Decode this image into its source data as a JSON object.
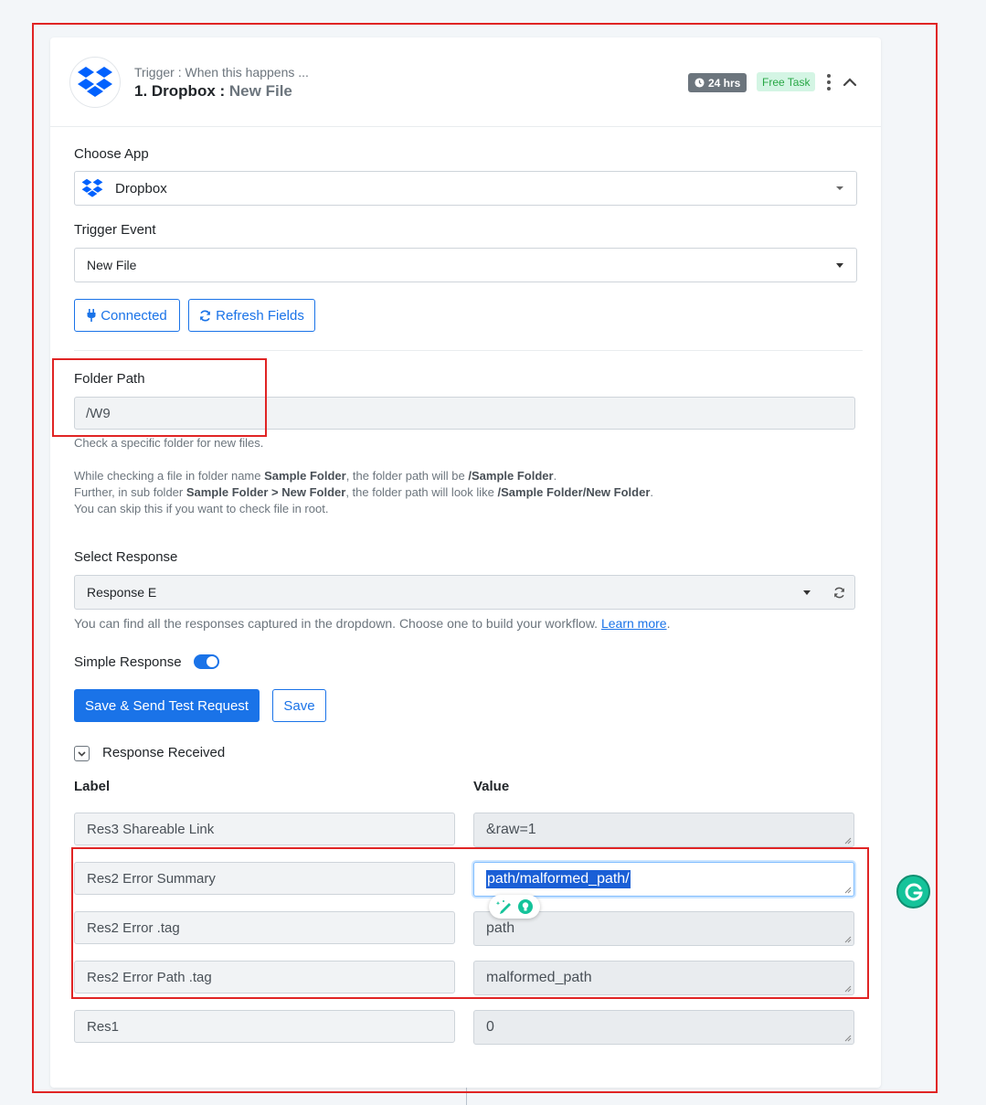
{
  "header": {
    "subtitle": "Trigger : When this happens ...",
    "title_prefix": "1. Dropbox :",
    "title_event": "New File",
    "hours_badge": "24 hrs",
    "task_badge": "Free Task"
  },
  "choose_app": {
    "label": "Choose App",
    "value": "Dropbox"
  },
  "trigger_event": {
    "label": "Trigger Event",
    "value": "New File"
  },
  "buttons": {
    "connected": "Connected",
    "refresh_fields": "Refresh Fields",
    "save_send": "Save & Send Test Request",
    "save": "Save"
  },
  "folder_path": {
    "label": "Folder Path",
    "value": "/W9",
    "help1": "Check a specific folder for new files.",
    "help2_a": "While checking a file in folder name ",
    "help2_b": "Sample Folder",
    "help2_c": ", the folder path will be ",
    "help2_d": "/Sample Folder",
    "help2_e": ".",
    "help3_a": "Further, in sub folder ",
    "help3_b": "Sample Folder > New Folder",
    "help3_c": ", the folder path will look like ",
    "help3_d": "/Sample Folder/New Folder",
    "help3_e": ".",
    "help4": "You can skip this if you want to check file in root."
  },
  "select_response": {
    "label": "Select Response",
    "value": "Response E",
    "help_text": "You can find all the responses captured in the dropdown. Choose one to build your workflow. ",
    "help_link": "Learn more",
    "help_end": "."
  },
  "simple_response": {
    "label": "Simple Response",
    "enabled": true
  },
  "response_received": {
    "label": "Response Received"
  },
  "table": {
    "label_header": "Label",
    "value_header": "Value",
    "rows": [
      {
        "label": "Res3 Shareable Link",
        "value": "&raw=1"
      },
      {
        "label": "Res2 Error Summary",
        "value": "path/malformed_path/"
      },
      {
        "label": "Res2 Error .tag",
        "value": "path"
      },
      {
        "label": "Res2 Error Path .tag",
        "value": "malformed_path"
      },
      {
        "label": "Res1",
        "value": "0"
      }
    ]
  },
  "colors": {
    "accent": "#1a73e8",
    "annotation": "#e02424",
    "free_task_bg": "#d4f5e4",
    "grammarly": "#15c39a"
  },
  "icons": [
    "dropbox-icon",
    "clock-icon",
    "kebab-icon",
    "chevron-up-icon",
    "plug-icon",
    "refresh-icon",
    "caret-down-icon",
    "chevron-down-icon",
    "grammarly-icon",
    "pencil-sparkle-icon",
    "lightbulb-icon"
  ]
}
